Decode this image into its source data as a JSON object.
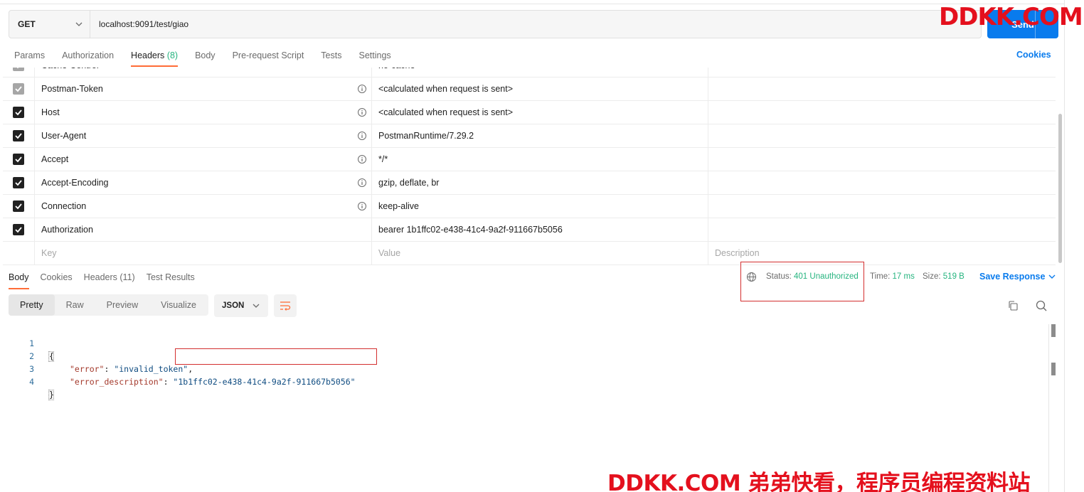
{
  "request": {
    "method": "GET",
    "url": "localhost:9091/test/giao",
    "send_label": "Send"
  },
  "watermark": {
    "top": "DDKK.COM",
    "bottom": "DDKK.COM 弟弟快看，程序员编程资料站"
  },
  "request_tabs": [
    {
      "label": "Params"
    },
    {
      "label": "Authorization"
    },
    {
      "label": "Headers",
      "count": "(8)"
    },
    {
      "label": "Body"
    },
    {
      "label": "Pre-request Script"
    },
    {
      "label": "Tests"
    },
    {
      "label": "Settings"
    }
  ],
  "cookies_link": "Cookies",
  "headers": {
    "rows": [
      {
        "key": "Cache-Control",
        "value": "no-cache"
      },
      {
        "key": "Postman-Token",
        "value": "<calculated when request is sent>"
      },
      {
        "key": "Host",
        "value": "<calculated when request is sent>"
      },
      {
        "key": "User-Agent",
        "value": "PostmanRuntime/7.29.2"
      },
      {
        "key": "Accept",
        "value": "*/*"
      },
      {
        "key": "Accept-Encoding",
        "value": "gzip, deflate, br"
      },
      {
        "key": "Connection",
        "value": "keep-alive"
      },
      {
        "key": "Authorization",
        "value": "bearer 1b1ffc02-e438-41c4-9a2f-911667b5056"
      }
    ],
    "placeholder": {
      "key": "Key",
      "value": "Value",
      "description": "Description"
    }
  },
  "response_tabs": [
    {
      "label": "Body"
    },
    {
      "label": "Cookies"
    },
    {
      "label": "Headers (11)"
    },
    {
      "label": "Test Results"
    }
  ],
  "response_meta": {
    "status_label": "Status:",
    "status_value": "401 Unauthorized",
    "time_label": "Time:",
    "time_value": "17 ms",
    "size_label": "Size:",
    "size_value": "519 B",
    "save_label": "Save Response"
  },
  "view_modes": [
    "Pretty",
    "Raw",
    "Preview",
    "Visualize"
  ],
  "format": "JSON",
  "body_lines": [
    {
      "n": "1",
      "open": "{"
    },
    {
      "n": "2",
      "key": "\"error\"",
      "sep": ": ",
      "val": "\"invalid_token\"",
      "tail": ","
    },
    {
      "n": "3",
      "key": "\"error_description\"",
      "sep": ": ",
      "val": "\"1b1ffc02-e438-41c4-9a2f-911667b5056\"",
      "tail": ""
    },
    {
      "n": "4",
      "open": "}"
    }
  ],
  "colors": {
    "accent": "#ff6c37",
    "primary": "#097bed",
    "status_green": "#26b47f",
    "annotation_red": "#d32f2f",
    "watermark_red": "#e4101d"
  }
}
